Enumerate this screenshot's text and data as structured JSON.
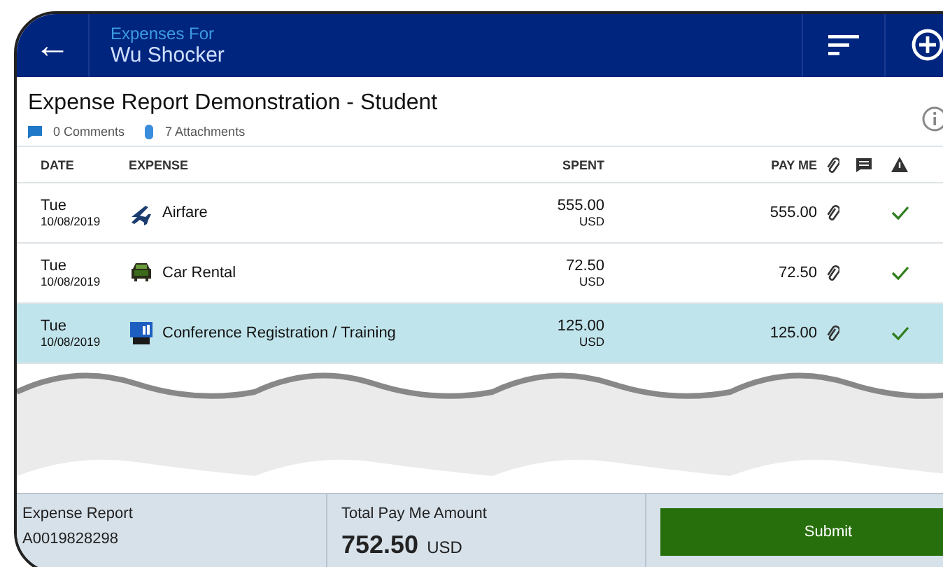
{
  "header": {
    "back_icon": "←",
    "subtitle": "Expenses For",
    "title": "Wu Shocker"
  },
  "report": {
    "title": "Expense Report Demonstration - Student",
    "comments": "0 Comments",
    "attachments": "7 Attachments"
  },
  "table": {
    "columns": [
      "DATE",
      "EXPENSE",
      "SPENT",
      "PAY ME"
    ],
    "rows": [
      {
        "day": "Tue",
        "date": "10/08/2019",
        "kind": "airfare",
        "expense": "Airfare",
        "spent": "555.00",
        "currency": "USD",
        "pay_me": "555.00",
        "attachment": true,
        "approved": true,
        "selected": false
      },
      {
        "day": "Tue",
        "date": "10/08/2019",
        "kind": "car",
        "expense": "Car Rental",
        "spent": "72.50",
        "currency": "USD",
        "pay_me": "72.50",
        "attachment": true,
        "approved": true,
        "selected": false
      },
      {
        "day": "Tue",
        "date": "10/08/2019",
        "kind": "conference",
        "expense": "Conference Registration / Training",
        "spent": "125.00",
        "currency": "USD",
        "pay_me": "125.00",
        "attachment": true,
        "approved": true,
        "selected": true
      }
    ]
  },
  "footer": {
    "report_label": "Expense Report",
    "report_id": "A0019828298",
    "total_label": "Total Pay Me Amount",
    "total": "752.50",
    "currency": "USD",
    "submit": "Submit"
  }
}
